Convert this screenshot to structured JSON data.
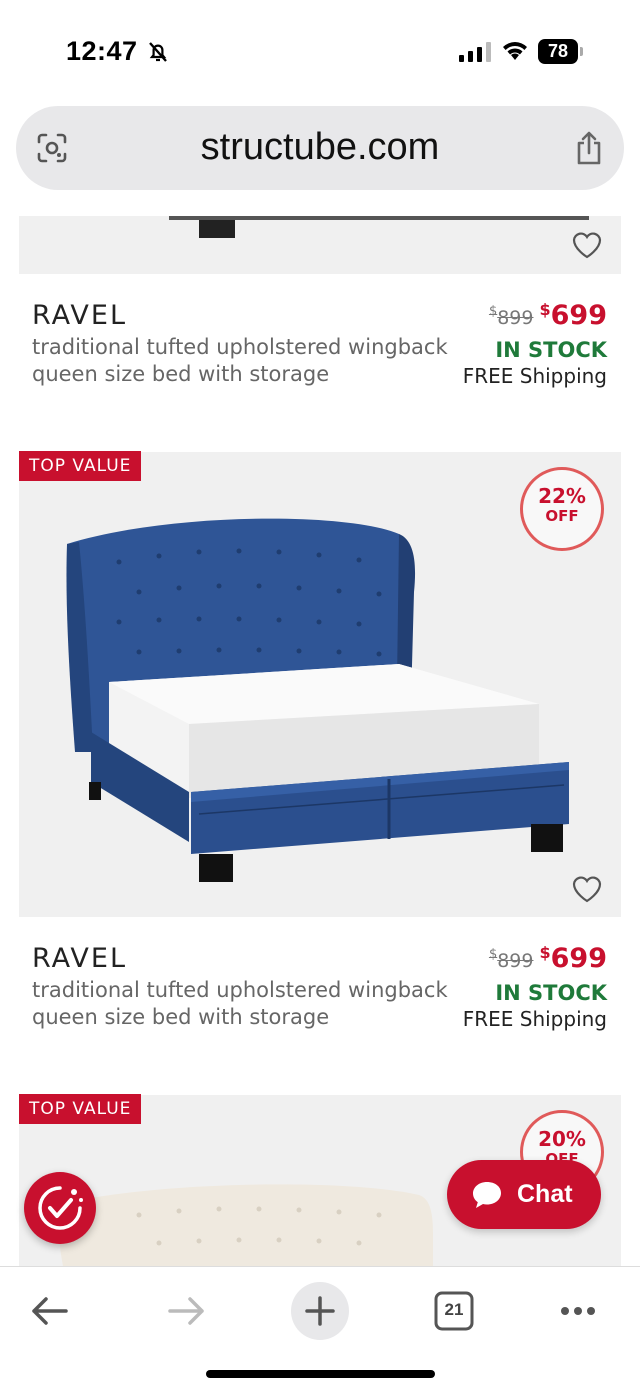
{
  "status_bar": {
    "time": "12:47",
    "battery": "78"
  },
  "browser": {
    "url": "structube.com",
    "tab_count": "21"
  },
  "products": [
    {
      "name": "RAVEL",
      "description": "traditional tufted upholstered wingback queen size bed with storage",
      "old_currency": "$",
      "old_price": "899",
      "new_currency": "$",
      "new_price": "699",
      "stock": "IN STOCK",
      "shipping": "FREE Shipping"
    },
    {
      "badge": "TOP VALUE",
      "discount_pct": "22%",
      "discount_off": "OFF",
      "name": "RAVEL",
      "description": "traditional tufted upholstered wingback queen size bed with storage",
      "old_currency": "$",
      "old_price": "899",
      "new_currency": "$",
      "new_price": "699",
      "stock": "IN STOCK",
      "shipping": "FREE Shipping",
      "bed_color": "#2b4f8e"
    },
    {
      "badge": "TOP VALUE",
      "discount_pct": "20%",
      "discount_off": "OFF",
      "bed_color": "#efe9df"
    }
  ],
  "chat": {
    "label": "Chat"
  },
  "colors": {
    "brand_red": "#c8102e",
    "stock_green": "#1f7a3a"
  },
  "icons": [
    "bell-slash-icon",
    "signal-icon",
    "wifi-icon",
    "battery-icon",
    "lens-icon",
    "share-icon",
    "heart-icon",
    "chat-bubble-icon",
    "promo-icon",
    "back-icon",
    "forward-icon",
    "plus-icon",
    "tabs-icon",
    "more-icon"
  ]
}
